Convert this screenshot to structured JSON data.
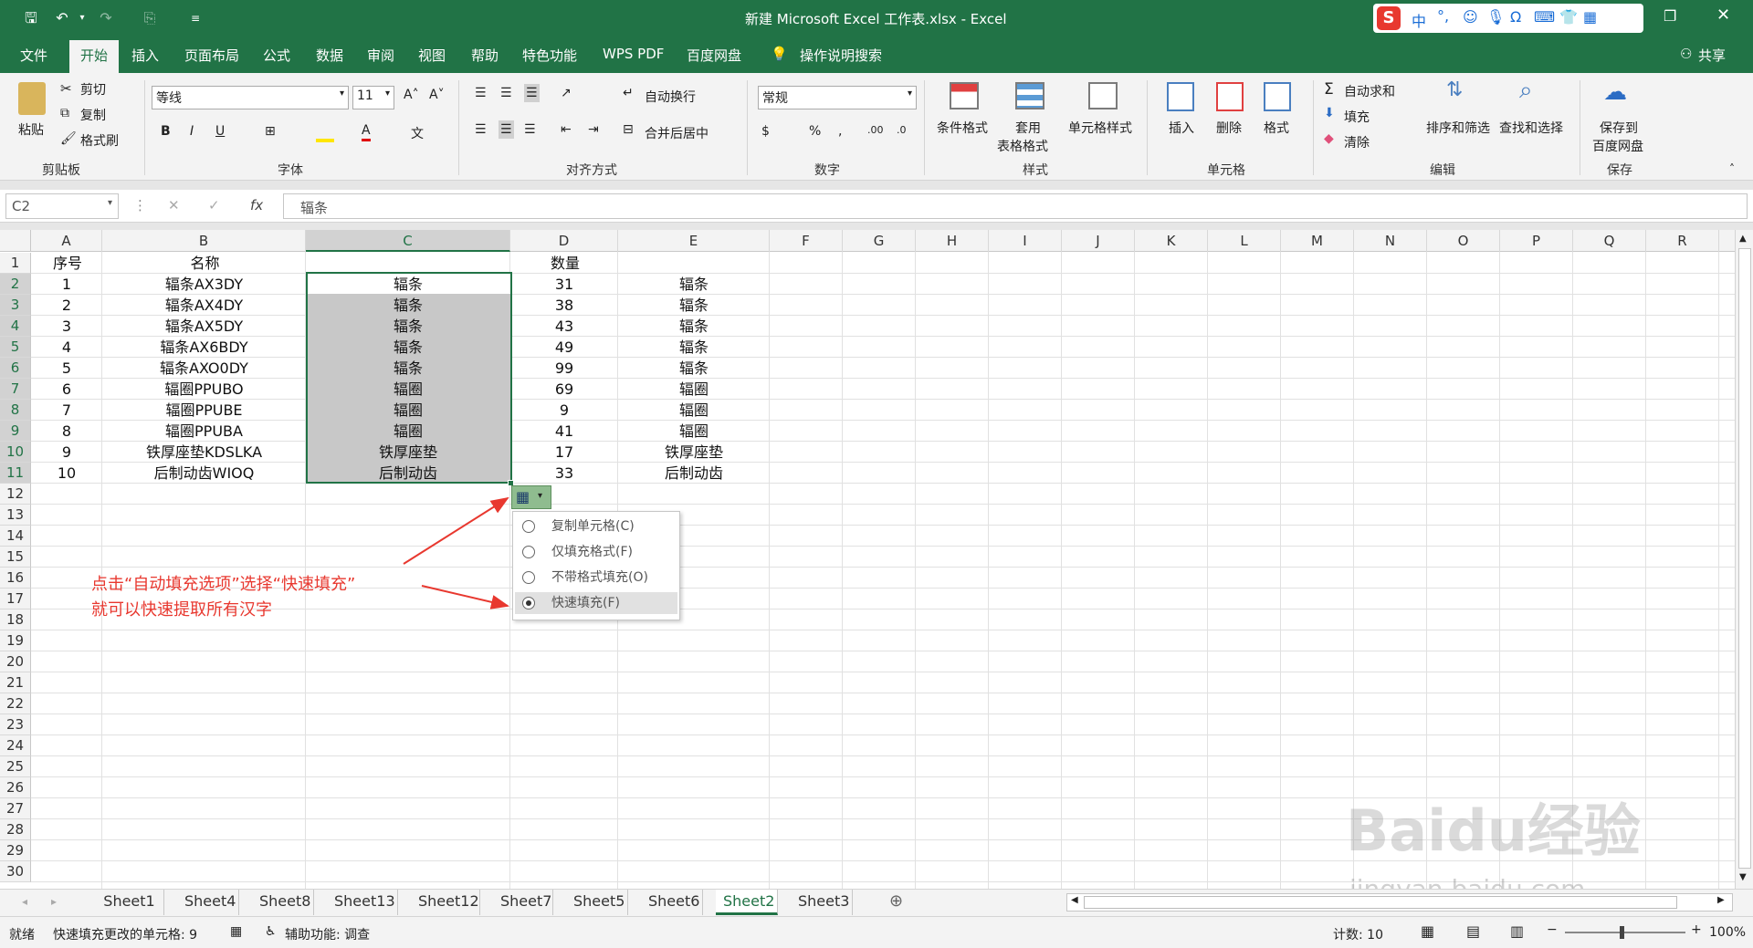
{
  "window": {
    "title": "新建 Microsoft Excel 工作表.xlsx  -  Excel"
  },
  "tabs": [
    "文件",
    "开始",
    "插入",
    "页面布局",
    "公式",
    "数据",
    "审阅",
    "视图",
    "帮助",
    "特色功能",
    "WPS PDF",
    "百度网盘"
  ],
  "tell_me": "操作说明搜索",
  "share": "共享",
  "ribbon": {
    "clipboard": {
      "paste": "粘贴",
      "cut": "剪切",
      "copy": "复制",
      "format_painter": "格式刷",
      "label": "剪贴板"
    },
    "font": {
      "name": "等线",
      "size": "11",
      "bold": "B",
      "italic": "I",
      "underline": "U",
      "label": "字体"
    },
    "alignment": {
      "wrap": "自动换行",
      "merge": "合并后居中",
      "label": "对齐方式"
    },
    "number": {
      "format": "常规",
      "label": "数字"
    },
    "styles": {
      "conditional": "条件格式",
      "table1": "套用",
      "table2": "表格格式",
      "cell_styles": "单元格样式",
      "label": "样式"
    },
    "cells": {
      "insert": "插入",
      "delete": "删除",
      "format": "格式",
      "label": "单元格"
    },
    "editing": {
      "autosum": "自动求和",
      "fill": "填充",
      "clear": "清除",
      "sort": "排序和筛选",
      "find": "查找和选择",
      "label": "编辑"
    },
    "save": {
      "line1": "保存到",
      "line2": "百度网盘",
      "label": "保存"
    }
  },
  "formula_bar": {
    "name_box": "C2",
    "fx": "fx",
    "content": "辐条"
  },
  "columns": [
    "A",
    "B",
    "C",
    "D",
    "E",
    "F",
    "G",
    "H",
    "I",
    "J",
    "K",
    "L",
    "M",
    "N",
    "O",
    "P",
    "Q",
    "R"
  ],
  "rows": [
    "1",
    "2",
    "3",
    "4",
    "5",
    "6",
    "7",
    "8",
    "9",
    "10",
    "11",
    "12",
    "13",
    "14",
    "15",
    "16",
    "17",
    "18",
    "19",
    "20",
    "21",
    "22",
    "23",
    "24",
    "25",
    "26",
    "27",
    "28",
    "29",
    "30"
  ],
  "table": {
    "headers": {
      "a": "序号",
      "b": "名称",
      "d": "数量"
    },
    "data": [
      {
        "a": "1",
        "b": "辐条AX3DY",
        "c": "辐条",
        "d": "31",
        "e": "辐条"
      },
      {
        "a": "2",
        "b": "辐条AX4DY",
        "c": "辐条",
        "d": "38",
        "e": "辐条"
      },
      {
        "a": "3",
        "b": "辐条AX5DY",
        "c": "辐条",
        "d": "43",
        "e": "辐条"
      },
      {
        "a": "4",
        "b": "辐条AX6BDY",
        "c": "辐条",
        "d": "49",
        "e": "辐条"
      },
      {
        "a": "5",
        "b": "辐条AXO0DY",
        "c": "辐条",
        "d": "99",
        "e": "辐条"
      },
      {
        "a": "6",
        "b": "辐圈PPUBO",
        "c": "辐圈",
        "d": "69",
        "e": "辐圈"
      },
      {
        "a": "7",
        "b": "辐圈PPUBE",
        "c": "辐圈",
        "d": "9",
        "e": "辐圈"
      },
      {
        "a": "8",
        "b": "辐圈PPUBA",
        "c": "辐圈",
        "d": "41",
        "e": "辐圈"
      },
      {
        "a": "9",
        "b": "铁厚座垫KDSLKA",
        "c": "铁厚座垫",
        "d": "17",
        "e": "铁厚座垫"
      },
      {
        "a": "10",
        "b": "后制动齿WIOQ",
        "c": "后制动齿",
        "d": "33",
        "e": "后制动齿"
      }
    ]
  },
  "autofill_menu": {
    "options": [
      "复制单元格(C)",
      "仅填充格式(F)",
      "不带格式填充(O)",
      "快速填充(F)"
    ],
    "selected": "快速填充(F)"
  },
  "annotation": {
    "line1": "点击“自动填充选项”选择“快速填充”",
    "line2": "就可以快速提取所有汉字"
  },
  "sheets": [
    "Sheet1",
    "Sheet4",
    "Sheet8",
    "Sheet13",
    "Sheet12",
    "Sheet7",
    "Sheet5",
    "Sheet6",
    "Sheet2",
    "Sheet3"
  ],
  "active_sheet": "Sheet2",
  "status": {
    "ready": "就绪",
    "flash_fill": "快速填充更改的单元格: 9",
    "accessibility": "辅助功能: 调查",
    "count": "计数: 10",
    "zoom": "100%"
  },
  "watermark": {
    "text1": "Baidu经验",
    "text2": "jingyan.baidu.com"
  },
  "colors": {
    "excel_green": "#217346",
    "annotation_red": "#e8382f",
    "selection_gray": "#c8c8c8"
  }
}
